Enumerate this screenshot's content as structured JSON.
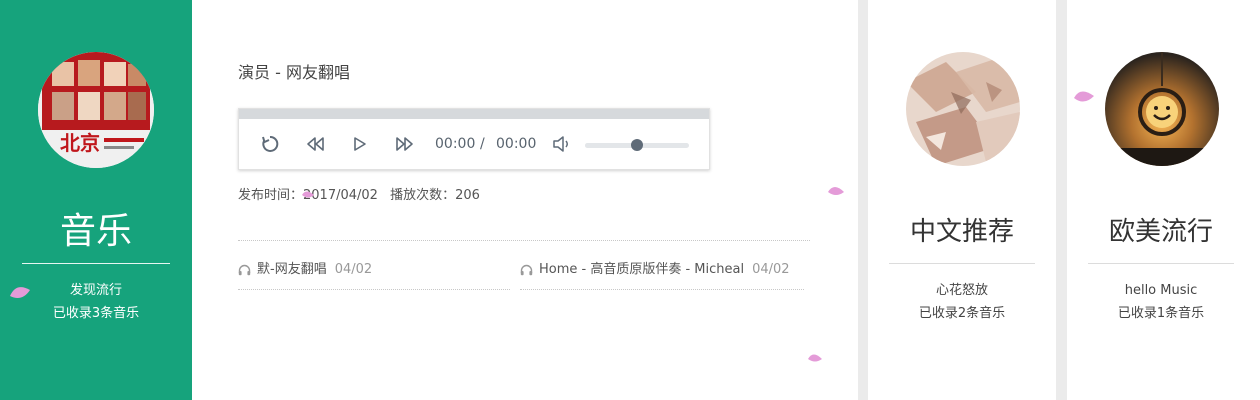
{
  "left_card": {
    "title": "音乐",
    "subtitle_line1": "发现流行",
    "subtitle_line2": "已收录3条音乐",
    "accent": "#16a37c"
  },
  "player": {
    "song_title": "演员 - 网友翻唱",
    "current_time": "00:00",
    "separator": "/",
    "duration": "00:00",
    "volume": 0.5,
    "controls": [
      "replay-icon",
      "rewind-icon",
      "play-icon",
      "fast-forward-icon",
      "volume-icon"
    ]
  },
  "meta": {
    "publish_label": "发布时间：2017/04/02",
    "play_count_label": "播放次数：206"
  },
  "tracks": [
    {
      "title": "默-网友翻唱",
      "date": "04/02"
    },
    {
      "title": "Home - 高音质原版伴奏 - Micheal",
      "date": "04/02"
    }
  ],
  "categories": [
    {
      "title": "中文推荐",
      "line1": "心花怒放",
      "line2": "已收录2条音乐"
    },
    {
      "title": "欧美流行",
      "line1": "hello Music",
      "line2": "已收录1条音乐"
    }
  ]
}
